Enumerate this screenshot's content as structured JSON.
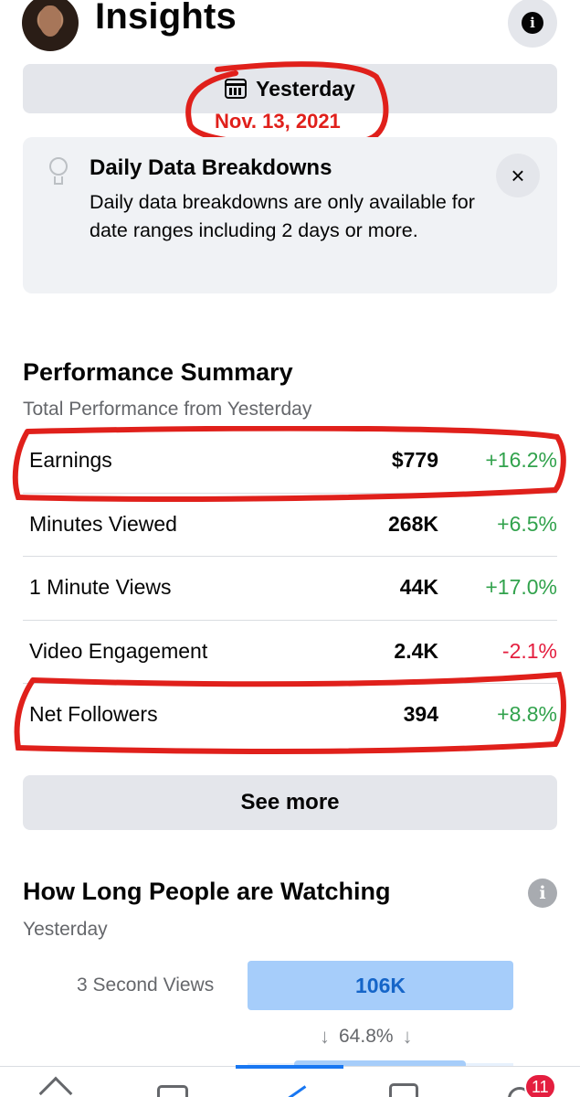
{
  "header": {
    "title": "Insights",
    "avatar_icon": "profile-photo",
    "info_icon": "i"
  },
  "date_filter": {
    "label": "Yesterday",
    "icon": "calendar-icon"
  },
  "annotations": {
    "date_text": "Nov. 13, 2021",
    "color": "#e0201b"
  },
  "tip": {
    "title": "Daily Data Breakdowns",
    "body": "Daily data breakdowns are only available for date ranges including 2 days or more.",
    "icon": "lightbulb-icon",
    "close_icon": "×"
  },
  "performance": {
    "title": "Performance Summary",
    "subtitle": "Total Performance from Yesterday",
    "metrics": [
      {
        "label": "Earnings",
        "value": "$779",
        "change": "+16.2%",
        "trend": "positive"
      },
      {
        "label": "Minutes Viewed",
        "value": "268K",
        "change": "+6.5%",
        "trend": "positive"
      },
      {
        "label": "1 Minute Views",
        "value": "44K",
        "change": "+17.0%",
        "trend": "positive"
      },
      {
        "label": "Video Engagement",
        "value": "2.4K",
        "change": "-2.1%",
        "trend": "negative"
      },
      {
        "label": "Net Followers",
        "value": "394",
        "change": "+8.8%",
        "trend": "positive"
      }
    ],
    "see_more_label": "See more"
  },
  "watching": {
    "title": "How Long People are Watching",
    "subtitle": "Yesterday",
    "info_icon": "i",
    "row_label": "3 Second Views",
    "row_value": "106K",
    "retention": "64.8%",
    "arrow": "↓"
  },
  "tabbar": {
    "items": [
      "home-icon",
      "profile-card-icon",
      "insights-icon",
      "content-icon",
      "notifications-icon"
    ],
    "active": "insights-icon",
    "notification_count": "11"
  },
  "colors": {
    "positive": "#31a24c",
    "negative": "#e41e3f",
    "accent": "#1877f2"
  }
}
